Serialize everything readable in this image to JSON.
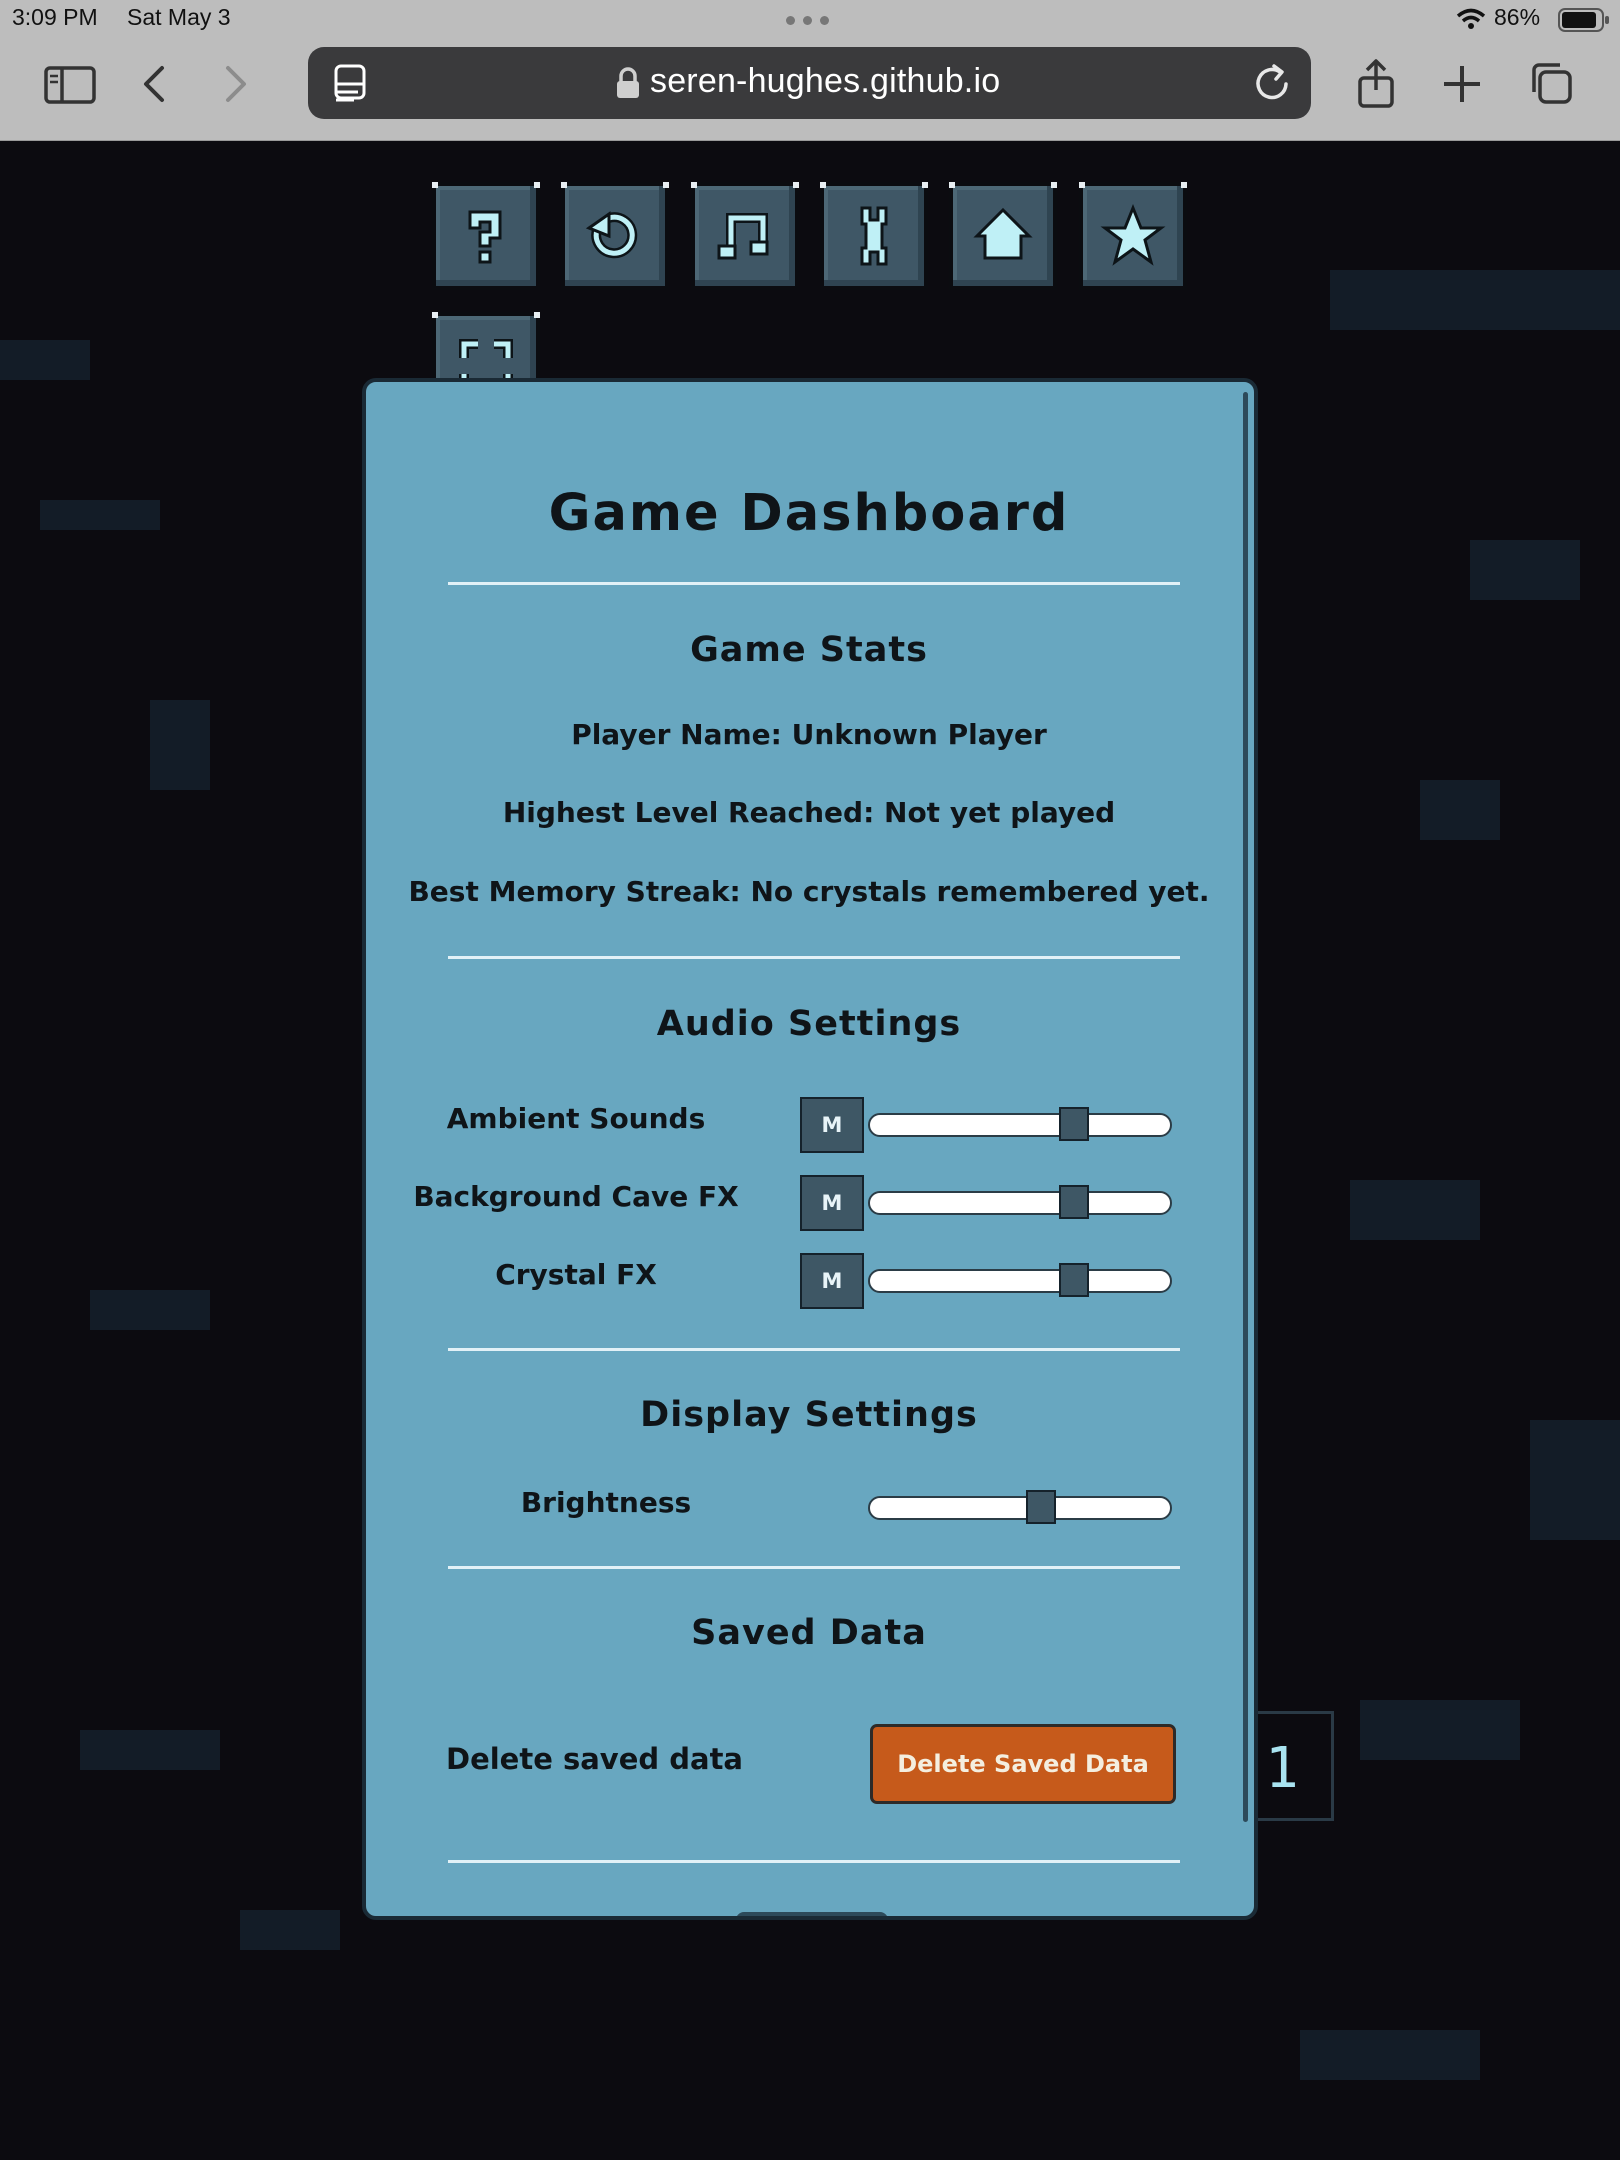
{
  "status_bar": {
    "time": "3:09 PM",
    "date": "Sat May 3",
    "battery": "86%"
  },
  "browser": {
    "url": "seren-hughes.github.io",
    "icons": [
      "sidebar-icon",
      "back-icon",
      "forward-icon",
      "tab-overview-icon",
      "lock-icon",
      "reload-icon",
      "share-icon",
      "new-tab-icon",
      "tabs-icon"
    ]
  },
  "toolbar": {
    "buttons": [
      "help-icon",
      "restart-icon",
      "music-icon",
      "wrench-icon",
      "home-icon",
      "star-icon",
      "fullscreen-icon"
    ]
  },
  "side_counter": "1",
  "dashboard": {
    "title": "Game Dashboard",
    "stats": {
      "heading": "Game Stats",
      "player_name": "Player Name: Unknown Player",
      "highest_level": "Highest Level Reached: Not yet played",
      "best_streak": "Best Memory Streak: No crystals remembered yet."
    },
    "audio": {
      "heading": "Audio Settings",
      "mute_label": "M",
      "rows": [
        {
          "label": "Ambient Sounds",
          "level": 0.68
        },
        {
          "label": "Background Cave FX",
          "level": 0.68
        },
        {
          "label": "Crystal FX",
          "level": 0.68
        }
      ]
    },
    "display": {
      "heading": "Display Settings",
      "brightness_label": "Brightness",
      "brightness_level": 0.57
    },
    "saved": {
      "heading": "Saved Data",
      "delete_label": "Delete saved data",
      "delete_button": "Delete Saved Data"
    }
  },
  "colors": {
    "panel": "#68a7c0",
    "delete_button": "#c65a1b",
    "button_stone": "#3f5766"
  }
}
